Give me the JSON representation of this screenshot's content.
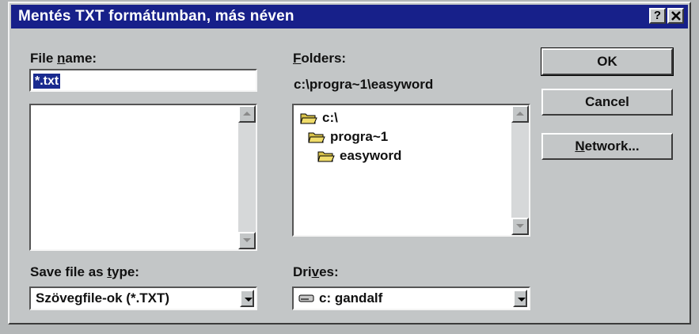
{
  "window": {
    "title": "Mentés TXT formátumban, más néven",
    "help_label": "?",
    "close_label": "✕"
  },
  "file_name": {
    "label_pre": "File ",
    "label_accel": "n",
    "label_post": "ame:",
    "value": "*.txt"
  },
  "folders": {
    "label_accel": "F",
    "label_post": "olders:",
    "current_path": "c:\\progra~1\\easyword",
    "items": [
      "c:\\",
      "progra~1",
      "easyword"
    ]
  },
  "save_as_type": {
    "label_pre": "Save file as ",
    "label_accel": "t",
    "label_post": "ype:",
    "value": "Szövegfile-ok (*.TXT)"
  },
  "drives": {
    "label_pre": "Dri",
    "label_accel": "v",
    "label_post": "es:",
    "value": "c: gandalf"
  },
  "buttons": {
    "ok": "OK",
    "cancel": "Cancel",
    "network_accel": "N",
    "network_rest": "etwork..."
  },
  "colors": {
    "titlebar": "#17208a",
    "face": "#c3c6c7",
    "selection": "#1a2b8f"
  },
  "icons": {
    "folder": "folder-icon",
    "drive": "hard-drive-icon"
  }
}
